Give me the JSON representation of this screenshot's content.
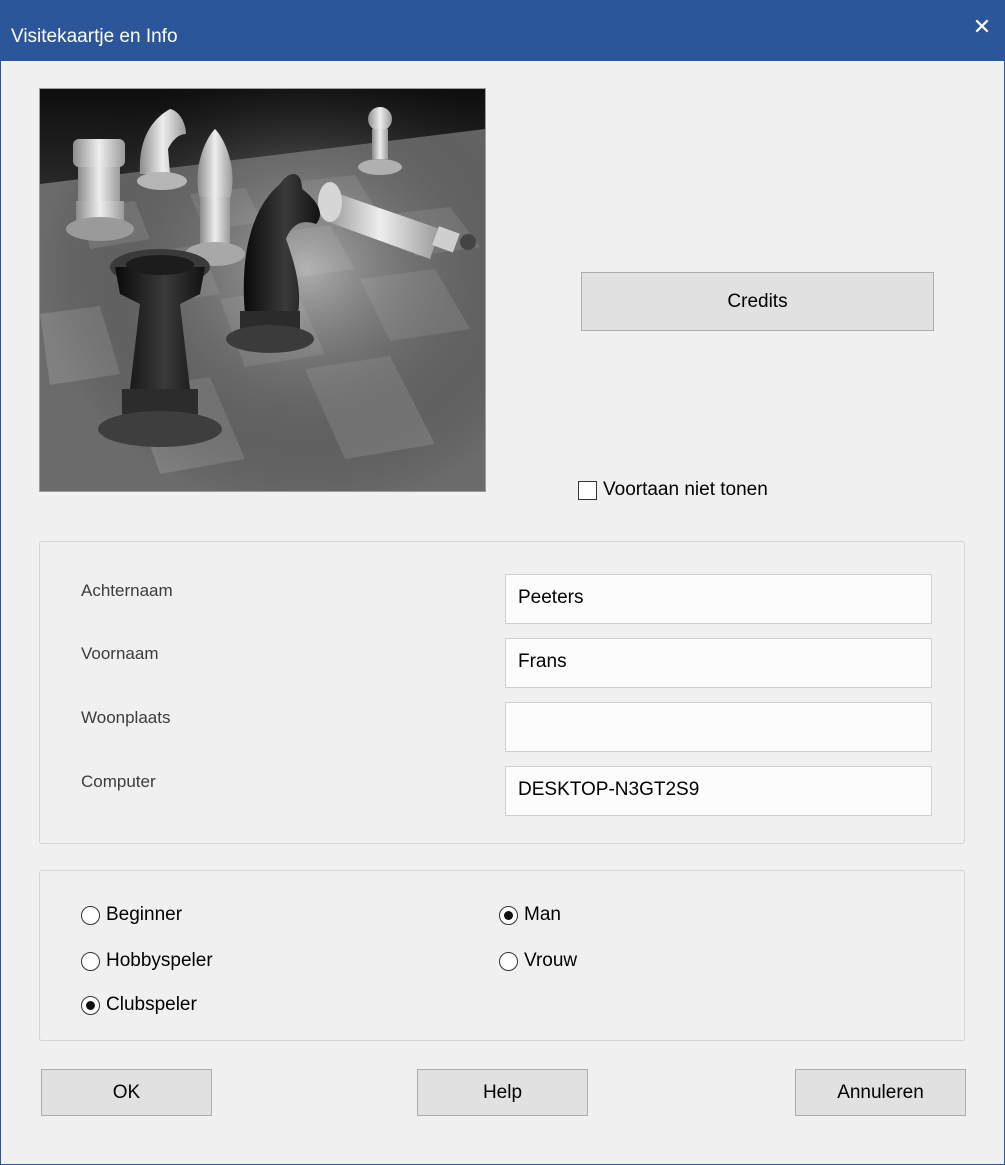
{
  "window": {
    "title": "Visitekaartje en Info",
    "close_symbol": "✕",
    "accent_color": "#2b579a"
  },
  "photo": {
    "description_icon": "chess-photo"
  },
  "credits_label": "Credits",
  "dont_show": {
    "label": "Voortaan niet tonen",
    "checked": false
  },
  "fields": {
    "lastname_label": "Achternaam",
    "lastname_value": "Peeters",
    "firstname_label": "Voornaam",
    "firstname_value": "Frans",
    "city_label": "Woonplaats",
    "city_value": "",
    "computer_label": "Computer",
    "computer_value": "DESKTOP-N3GT2S9"
  },
  "level": {
    "beginner": "Beginner",
    "hobby": "Hobbyspeler",
    "club": "Clubspeler",
    "selected": "Clubspeler"
  },
  "gender": {
    "man": "Man",
    "woman": "Vrouw",
    "selected": "Man"
  },
  "buttons": {
    "ok": "OK",
    "help": "Help",
    "cancel": "Annuleren"
  }
}
